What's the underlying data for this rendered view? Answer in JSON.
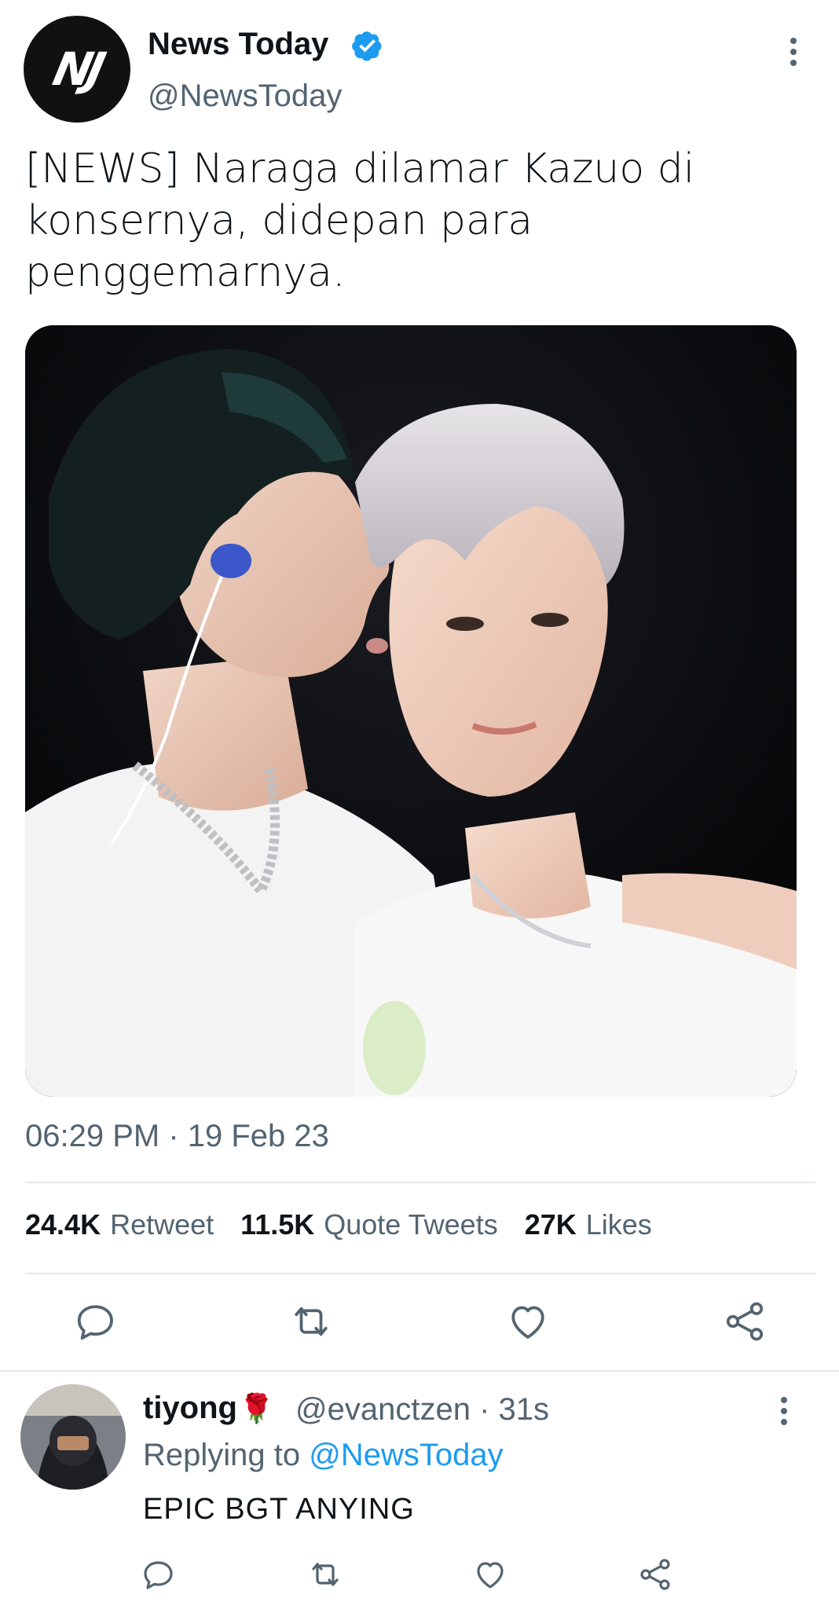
{
  "tweet": {
    "avatar_text": "NJ",
    "display_name": "News Today",
    "handle": "@NewsToday",
    "text": "[NEWS] Naraga dilamar Kazuo di konsernya, didepan para penggemarnya.",
    "timestamp": "06:29 PM · 19 Feb 23",
    "stats": {
      "retweets_count": "24.4K",
      "retweets_label": "Retweet",
      "quotes_count": "11.5K",
      "quotes_label": "Quote Tweets",
      "likes_count": "27K",
      "likes_label": "Likes"
    }
  },
  "reply": {
    "display_name": "tiyong",
    "emoji": "🌹",
    "handle_time": "@evanctzen · 31s",
    "replying_prefix": "Replying to",
    "replying_handle": "@NewsToday",
    "text": "EPIC BGT ANYING"
  },
  "colors": {
    "accent": "#1d9bf0",
    "text_primary": "#0f1419",
    "text_secondary": "#536471",
    "divider": "#e4e8eb"
  },
  "icons": [
    "verified-badge-icon",
    "more-options-icon",
    "reply-icon",
    "retweet-icon",
    "like-icon",
    "share-icon",
    "rose-emoji-icon"
  ]
}
